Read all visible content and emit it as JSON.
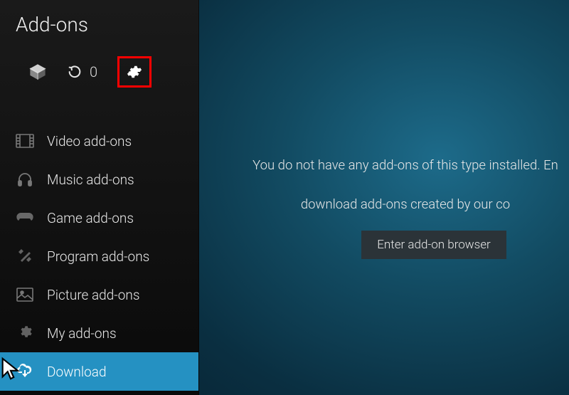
{
  "header": {
    "title": "Add-ons"
  },
  "toolbar": {
    "count": "0"
  },
  "nav": {
    "items": [
      {
        "label": "Video add-ons"
      },
      {
        "label": "Music add-ons"
      },
      {
        "label": "Game add-ons"
      },
      {
        "label": "Program add-ons"
      },
      {
        "label": "Picture add-ons"
      },
      {
        "label": "My add-ons"
      },
      {
        "label": "Download"
      }
    ]
  },
  "content": {
    "empty_line1": "You do not have any add-ons of this type installed. En",
    "empty_line2": "download add-ons created by our co",
    "browser_button": "Enter add-on browser"
  }
}
